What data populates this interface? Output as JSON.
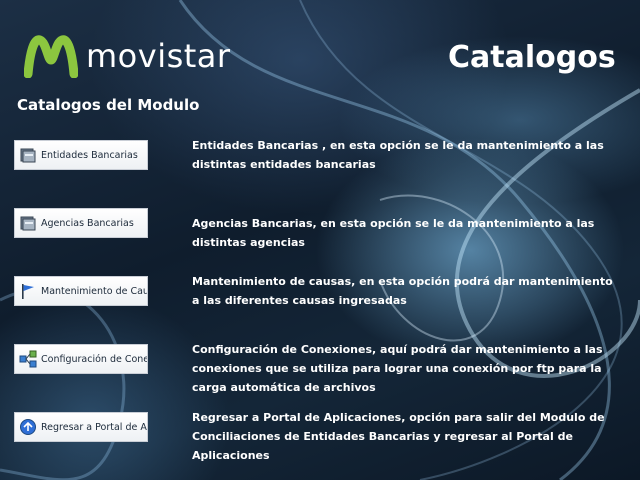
{
  "brand": {
    "name": "movistar",
    "logo_icon": "movistar-m-logo"
  },
  "page": {
    "title": "Catalogos"
  },
  "section": {
    "title": "Catalogos del Modulo"
  },
  "items": [
    {
      "label": "Entidades Bancarias",
      "icon": "bank-entities-icon",
      "description": "Entidades Bancarias , en esta opción se le da mantenimiento a las distintas entidades bancarias"
    },
    {
      "label": "Agencias Bancarias",
      "icon": "bank-agencies-icon",
      "description": "Agencias Bancarias, en esta opción se le da mantenimiento a las distintas agencias"
    },
    {
      "label": "Mantenimiento de Causas",
      "icon": "flag-icon",
      "description": "Mantenimiento de causas, en esta opción podrá dar mantenimiento a las diferentes causas ingresadas"
    },
    {
      "label": "Configuración de Conexiones",
      "icon": "network-connections-icon",
      "description": "Configuración de Conexiones, aquí podrá dar mantenimiento a las conexiones que se utiliza para lograr una conexión por ftp para la carga automática de archivos"
    },
    {
      "label": "Regresar a Portal de Aplicaciones",
      "icon": "back-to-portal-icon",
      "description": "Regresar a Portal de Aplicaciones, opción para salir del Modulo de Conciliaciones de Entidades Bancarias y regresar al Portal de Aplicaciones"
    }
  ],
  "colors": {
    "logo_green": "#8cc63f",
    "button_text": "#1c2a3a",
    "text": "#ffffff"
  }
}
